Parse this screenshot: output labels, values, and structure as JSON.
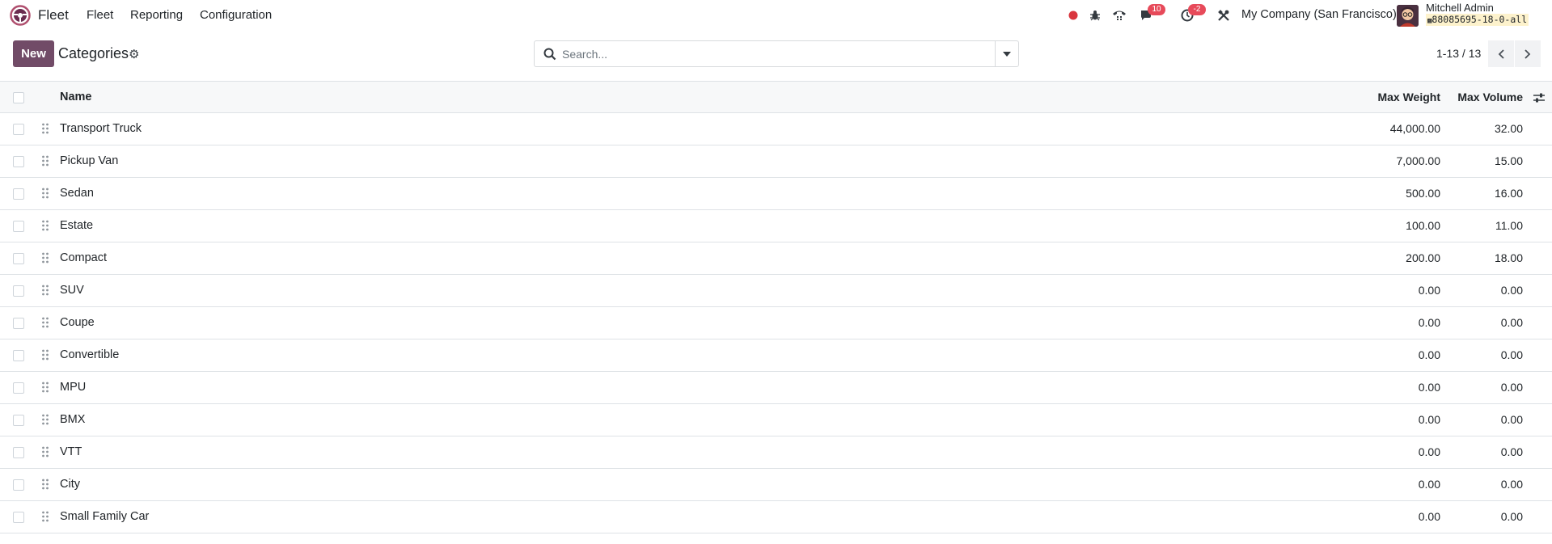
{
  "navbar": {
    "app_name": "Fleet",
    "menu": [
      "Fleet",
      "Reporting",
      "Configuration"
    ],
    "messages_badge": "10",
    "activities_badge": "-2",
    "company": "My Company (San Francisco)",
    "user_name": "Mitchell Admin",
    "database": "88085695-18-0-all",
    "icons": [
      "recording-dot-icon",
      "bug-icon",
      "phone-icon",
      "chat-icon",
      "clock-icon",
      "tools-icon"
    ],
    "colors": {
      "record_dot": "#d9363e",
      "badge": "#e74a5a",
      "brand": "#714b67"
    }
  },
  "control_panel": {
    "new_label": "New",
    "title": "Categories",
    "search_placeholder": "Search...",
    "pager": "1-13 / 13"
  },
  "list": {
    "headers": {
      "name": "Name",
      "max_weight": "Max Weight",
      "max_volume": "Max Volume"
    },
    "rows": [
      {
        "name": "Transport Truck",
        "max_weight": "44,000.00",
        "max_volume": "32.00"
      },
      {
        "name": "Pickup Van",
        "max_weight": "7,000.00",
        "max_volume": "15.00"
      },
      {
        "name": "Sedan",
        "max_weight": "500.00",
        "max_volume": "16.00"
      },
      {
        "name": "Estate",
        "max_weight": "100.00",
        "max_volume": "11.00"
      },
      {
        "name": "Compact",
        "max_weight": "200.00",
        "max_volume": "18.00"
      },
      {
        "name": "SUV",
        "max_weight": "0.00",
        "max_volume": "0.00"
      },
      {
        "name": "Coupe",
        "max_weight": "0.00",
        "max_volume": "0.00"
      },
      {
        "name": "Convertible",
        "max_weight": "0.00",
        "max_volume": "0.00"
      },
      {
        "name": "MPU",
        "max_weight": "0.00",
        "max_volume": "0.00"
      },
      {
        "name": "BMX",
        "max_weight": "0.00",
        "max_volume": "0.00"
      },
      {
        "name": "VTT",
        "max_weight": "0.00",
        "max_volume": "0.00"
      },
      {
        "name": "City",
        "max_weight": "0.00",
        "max_volume": "0.00"
      },
      {
        "name": "Small Family Car",
        "max_weight": "0.00",
        "max_volume": "0.00"
      }
    ]
  }
}
